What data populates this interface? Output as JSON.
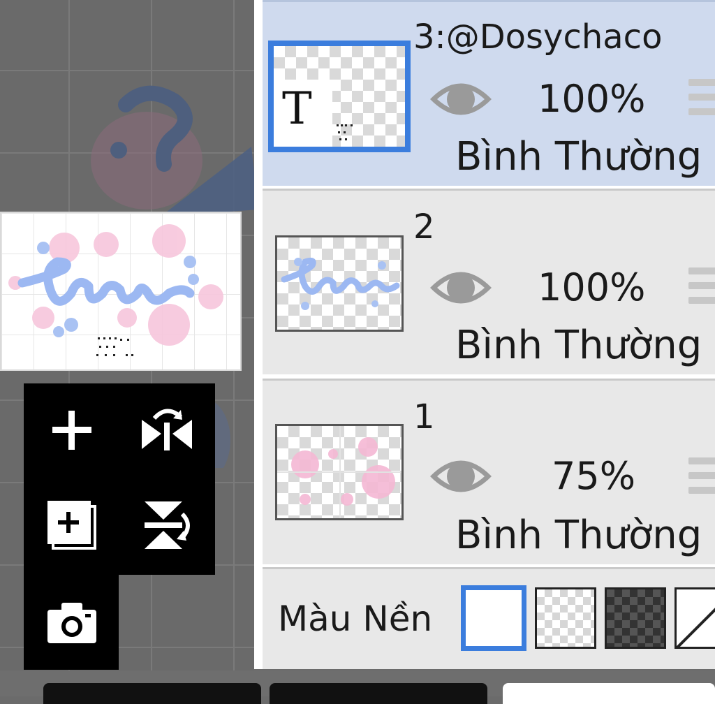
{
  "layers": [
    {
      "name": "3:@Dosychaco",
      "opacity": "100%",
      "blend": "Bình Thường",
      "thumb_label": "T",
      "selected": true
    },
    {
      "name": "2",
      "opacity": "100%",
      "blend": "Bình Thường",
      "selected": false
    },
    {
      "name": "1",
      "opacity": "75%",
      "blend": "Bình Thường",
      "selected": false
    }
  ],
  "background": {
    "label": "Màu Nền",
    "swatches": [
      "white",
      "transparent-light",
      "transparent-dark",
      "diagonal"
    ],
    "selected": "white"
  },
  "tools": [
    {
      "icon": "plus-icon"
    },
    {
      "icon": "flip-horizontal-icon"
    },
    {
      "icon": "add-layer-icon"
    },
    {
      "icon": "flip-vertical-icon"
    },
    {
      "icon": "camera-icon"
    }
  ],
  "colors": {
    "accent": "#3b7ddd",
    "selected_row": "#cfdaee",
    "row": "#e8e8e8",
    "lettering_blue": "#9cb8f2",
    "flower_pink": "#f5b8d4"
  }
}
